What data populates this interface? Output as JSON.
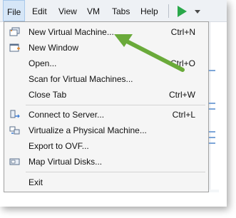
{
  "menubar": {
    "items": [
      {
        "label": "File",
        "active": true
      },
      {
        "label": "Edit",
        "active": false
      },
      {
        "label": "View",
        "active": false
      },
      {
        "label": "VM",
        "active": false
      },
      {
        "label": "Tabs",
        "active": false
      },
      {
        "label": "Help",
        "active": false
      }
    ],
    "play_icon": "play-icon",
    "caret_icon": "chevron-down-icon"
  },
  "file_menu": {
    "items": [
      {
        "label": "New Virtual Machine...",
        "shortcut": "Ctrl+N",
        "icon": "new-vm-icon"
      },
      {
        "label": "New Window",
        "shortcut": "",
        "icon": "new-window-icon"
      },
      {
        "label": "Open...",
        "shortcut": "Ctrl+O",
        "icon": ""
      },
      {
        "label": "Scan for Virtual Machines...",
        "shortcut": "",
        "icon": ""
      },
      {
        "label": "Close Tab",
        "shortcut": "Ctrl+W",
        "icon": ""
      },
      {
        "label": "Connect to Server...",
        "shortcut": "Ctrl+L",
        "icon": "connect-server-icon"
      },
      {
        "label": "Virtualize a Physical Machine...",
        "shortcut": "",
        "icon": "virtualize-icon"
      },
      {
        "label": "Export to OVF...",
        "shortcut": "",
        "icon": ""
      },
      {
        "label": "Map Virtual Disks...",
        "shortcut": "",
        "icon": "map-disks-icon"
      },
      {
        "label": "Exit",
        "shortcut": "",
        "icon": ""
      }
    ]
  },
  "colors": {
    "arrow": "#6aaa3a",
    "play": "#2aa84a",
    "menu_active_bg": "#d6e6f7"
  }
}
